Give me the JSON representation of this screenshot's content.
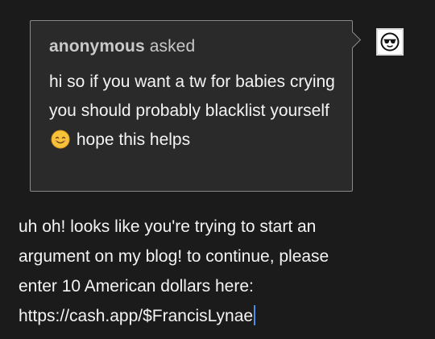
{
  "ask": {
    "asker": "anonymous",
    "asked_label": "asked",
    "body_before_emoji": "hi so if you want a tw for babies crying you should probably blacklist yourself",
    "emoji": "smiling-face-icon",
    "body_after_emoji": "hope this helps"
  },
  "answer": {
    "lines": [
      "uh oh! looks like you're trying to start an",
      "argument on my blog! to continue, please",
      "enter 10 American dollars here:",
      "https://cash.app/$FrancisLynae"
    ]
  },
  "avatar": {
    "icon": "sunglasses-face-icon"
  },
  "colors": {
    "background": "#1b1b1b",
    "ask_box": "#2a2a2a",
    "border": "#8a8a8a",
    "cursor": "#4a90e2"
  }
}
